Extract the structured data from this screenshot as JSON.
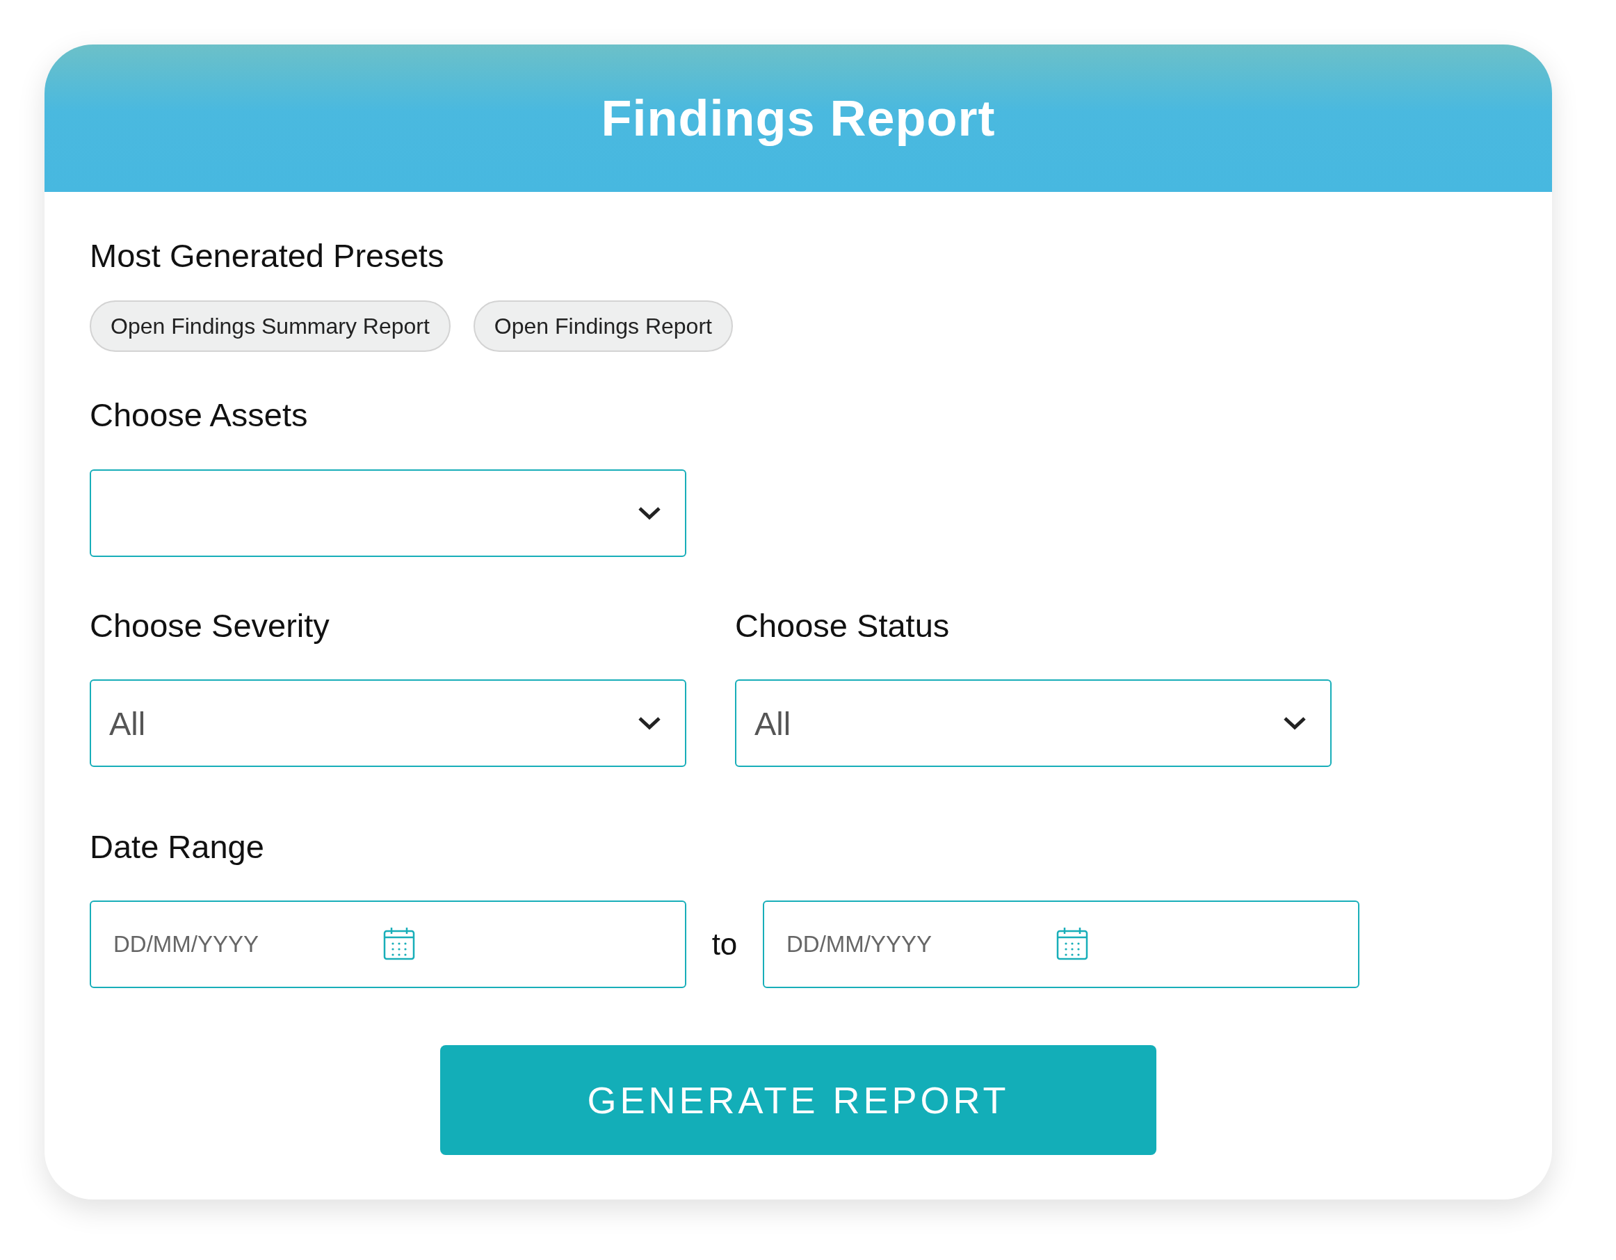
{
  "header": {
    "title": "Findings Report"
  },
  "presets": {
    "label": "Most Generated Presets",
    "chips": [
      {
        "label": "Open Findings Summary Report"
      },
      {
        "label": "Open Findings Report"
      }
    ]
  },
  "assets": {
    "label": "Choose Assets"
  },
  "severity": {
    "label": "Choose Severity",
    "value": "All"
  },
  "status": {
    "label": "Choose Status",
    "value": "All"
  },
  "date_range": {
    "label": "Date Range",
    "from": {
      "placeholder": "DD/MM/YYYY"
    },
    "separator": "to",
    "to": {
      "placeholder": "DD/MM/YYYY"
    }
  },
  "button": {
    "label": "GENERATE REPORT"
  }
}
